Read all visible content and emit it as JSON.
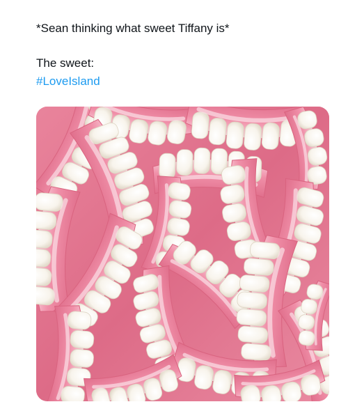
{
  "post": {
    "text_line_1": "*Sean thinking what sweet Tiffany is*",
    "text_line_2": "The sweet:",
    "hashtag": "#LoveIsland",
    "hashtag_color": "#1d9bf0",
    "text_color": "#0f1419"
  },
  "image": {
    "subject": "pile of pink and white teeth-shaped gummy candies",
    "colors": {
      "gum_pink": "#ee8ea6",
      "gum_light": "#f7c9d5",
      "teeth_white": "#fdfbf6",
      "teeth_shadow": "#e9e2d6",
      "background_pink": "#e3748f"
    }
  }
}
